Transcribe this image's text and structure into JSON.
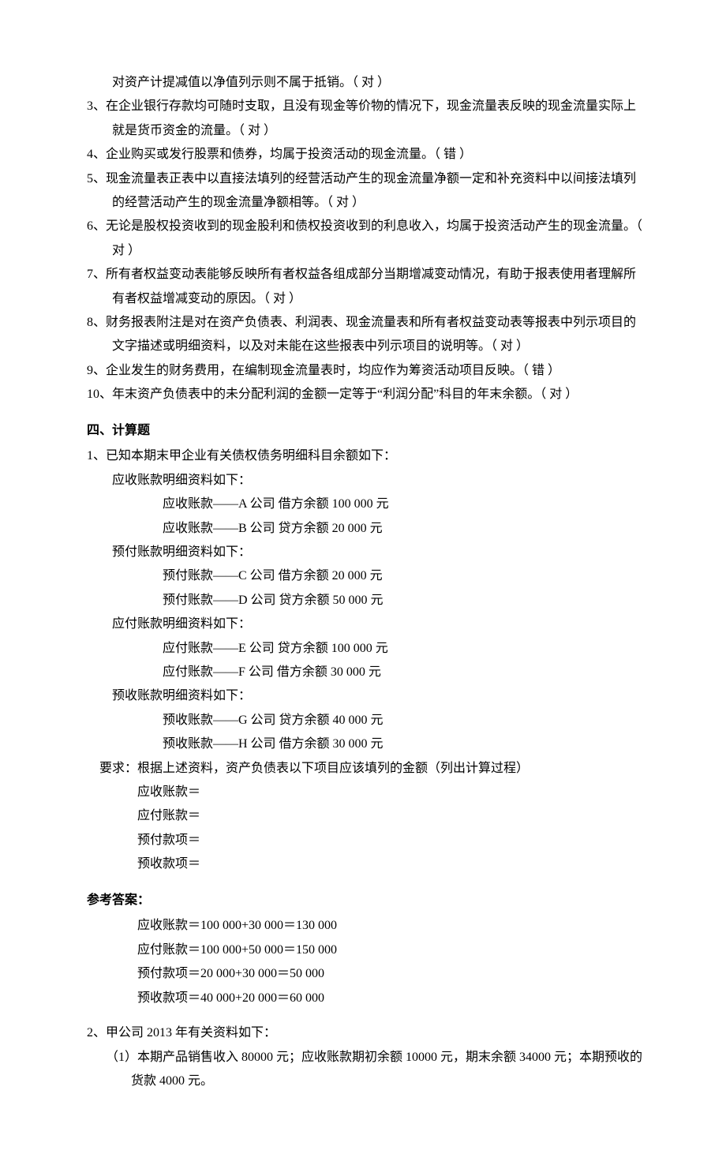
{
  "cont2": "对资产计提减值以净值列示则不属于抵销。（   对    ）",
  "q3": "3、在企业银行存款均可随时支取，且没有现金等价物的情况下，现金流量表反映的现金流量实际上就是货币资金的流量。（   对    ）",
  "q4": "4、企业购买或发行股票和债券，均属于投资活动的现金流量。（    错    ）",
  "q5": "5、现金流量表正表中以直接法填列的经营活动产生的现金流量净额一定和补充资料中以间接法填列的经营活动产生的现金流量净额相等。（    对    ）",
  "q6": "6、无论是股权投资收到的现金股利和债权投资收到的利息收入，均属于投资活动产生的现金流量。（     对     ）",
  "q7": "7、所有者权益变动表能够反映所有者权益各组成部分当期增减变动情况，有助于报表使用者理解所有者权益增减变动的原因。（   对   ）",
  "q8": "8、财务报表附注是对在资产负债表、利润表、现金流量表和所有者权益变动表等报表中列示项目的文字描述或明细资料，以及对未能在这些报表中列示项目的说明等。（   对    ）",
  "q9": "9、企业发生的财务费用，在编制现金流量表时，均应作为筹资活动项目反映。（   错   ）",
  "q10": "10、年末资产负债表中的未分配利润的金额一定等于“利润分配”科目的年末余额。（  对   ）",
  "sec4_title": "四、计算题",
  "p1_intro": "1、已知本期末甲企业有关债权债务明细科目余额如下：",
  "p1_ar_h": "应收账款明细资料如下：",
  "p1_ar_a": "应收账款——A 公司  借方余额 100 000 元",
  "p1_ar_b": "应收账款——B 公司  贷方余额 20 000 元",
  "p1_pp_h": "预付账款明细资料如下：",
  "p1_pp_c": "预付账款——C 公司  借方余额 20 000 元",
  "p1_pp_d": "预付账款——D 公司  贷方余额 50 000 元",
  "p1_ap_h": "应付账款明细资料如下：",
  "p1_ap_e": "应付账款——E 公司  贷方余额 100 000 元",
  "p1_ap_f": "应付账款——F 公司  借方余额 30 000 元",
  "p1_adv_h": "预收账款明细资料如下：",
  "p1_adv_g": "预收账款——G 公司  贷方余额 40 000 元",
  "p1_adv_hco": "预收账款——H 公司  借方余额 30 000 元",
  "p1_req": "要求：根据上述资料，资产负债表以下项目应该填列的金额（列出计算过程）",
  "p1_f_ar": "应收账款＝",
  "p1_f_ap": "应付账款＝",
  "p1_f_pp": "预付款项＝",
  "p1_f_adv": "预收款项＝",
  "ans_title": "参考答案：",
  "ans_ar": "应收账款＝100 000+30 000＝130 000",
  "ans_ap": "应付账款＝100 000+50 000＝150 000",
  "ans_pp": "预付款项＝20 000+30 000＝50 000",
  "ans_adv": "预收款项＝40 000+20 000＝60 000",
  "p2_intro": "2、甲公司 2013 年有关资料如下：",
  "p2_1": "（1）本期产品销售收入 80000 元；应收账款期初余额 10000 元，期末余额 34000 元；本期预收的货款 4000 元。"
}
